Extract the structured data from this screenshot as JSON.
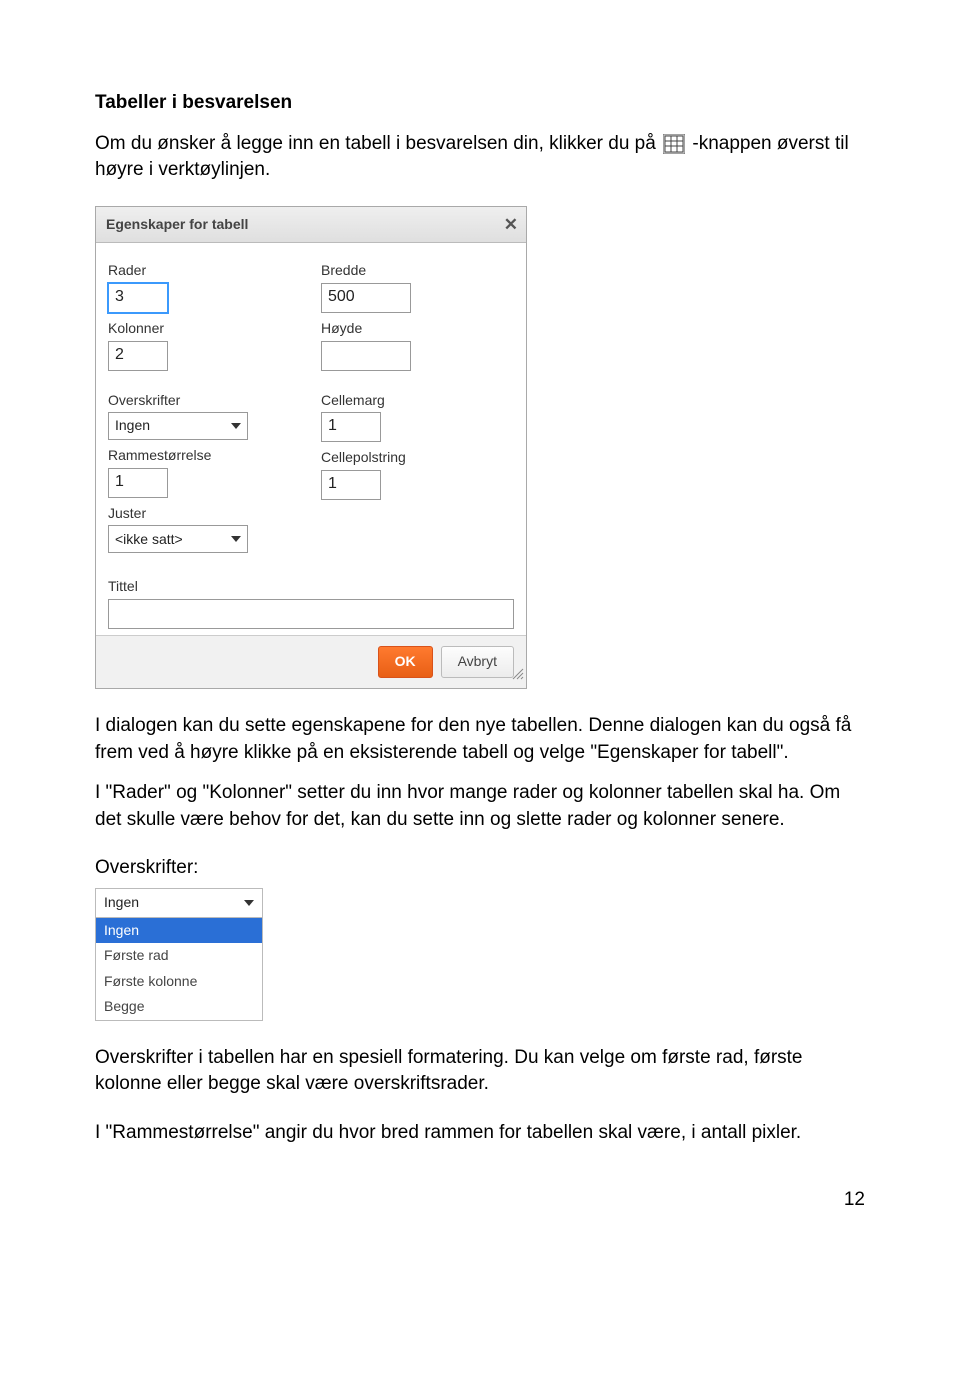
{
  "heading": "Tabeller i besvarelsen",
  "intro_part1": "Om du ønsker å legge inn en tabell i besvarelsen din, klikker du på ",
  "intro_part2": "-knappen øverst til høyre i verktøylinjen.",
  "dialog": {
    "title": "Egenskaper for tabell",
    "close_glyph": "✕",
    "left": {
      "rader_label": "Rader",
      "rader_value": "3",
      "kolonner_label": "Kolonner",
      "kolonner_value": "2",
      "overskrifter_label": "Overskrifter",
      "overskrifter_value": "Ingen",
      "ramme_label": "Rammestørrelse",
      "ramme_value": "1",
      "juster_label": "Juster",
      "juster_value": "<ikke satt>"
    },
    "right": {
      "bredde_label": "Bredde",
      "bredde_value": "500",
      "hoyde_label": "Høyde",
      "hoyde_value": "",
      "cellemarg_label": "Cellemarg",
      "cellemarg_value": "1",
      "cellepol_label": "Cellepolstring",
      "cellepol_value": "1"
    },
    "tittel_label": "Tittel",
    "tittel_value": "",
    "ok_label": "OK",
    "cancel_label": "Avbryt"
  },
  "para2": "I dialogen kan du sette egenskapene for den nye tabellen. Denne dialogen kan du også få frem ved å høyre klikke på en eksisterende tabell og velge \"Egenskaper for tabell\".",
  "para3": "I \"Rader\" og \"Kolonner\" setter du inn hvor mange rader og kolonner tabellen skal ha. Om det skulle være behov for det, kan du sette inn og slette rader og kolonner senere.",
  "overskrifter_label": "Overskrifter:",
  "dropdown": {
    "selected": "Ingen",
    "options": [
      "Ingen",
      "Første rad",
      "Første kolonne",
      "Begge"
    ]
  },
  "para4": "Overskrifter i tabellen har en spesiell formatering. Du kan velge om første rad, første kolonne eller begge skal være overskriftsrader.",
  "para5": "I \"Rammestørrelse\" angir du hvor bred rammen for tabellen skal være, i antall pixler.",
  "page_number": "12"
}
